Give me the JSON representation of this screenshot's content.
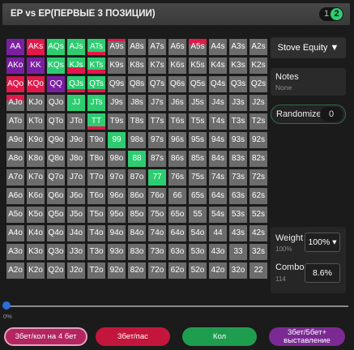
{
  "header": {
    "title": "EP vs EP(ПЕРВЫЕ 3 ПОЗИЦИИ)",
    "page_1": "1",
    "page_2": "2"
  },
  "colors": {
    "raise": "#e0194a",
    "call": "#2ecc71",
    "allin": "#7b1fa2",
    "fold": "#6c6c6c"
  },
  "grid": {
    "cells": [
      {
        "label": "AA",
        "fills": [
          {
            "color": "allin",
            "pct": 100
          }
        ]
      },
      {
        "label": "AKs",
        "fills": [
          {
            "color": "raise",
            "pct": 100
          }
        ]
      },
      {
        "label": "AQs",
        "fills": [
          {
            "color": "call",
            "pct": 100
          }
        ]
      },
      {
        "label": "AJs",
        "fills": [
          {
            "color": "call",
            "pct": 100
          }
        ]
      },
      {
        "label": "ATs",
        "fills": [
          {
            "color": "call",
            "pct": 80
          },
          {
            "color": "raise",
            "pct": 20
          }
        ]
      },
      {
        "label": "A9s",
        "fills": [
          {
            "color": "raise",
            "pct": 15
          }
        ]
      },
      {
        "label": "A8s",
        "fills": []
      },
      {
        "label": "A7s",
        "fills": []
      },
      {
        "label": "A6s",
        "fills": []
      },
      {
        "label": "A5s",
        "fills": [
          {
            "color": "raise",
            "pct": 35
          }
        ]
      },
      {
        "label": "A4s",
        "fills": []
      },
      {
        "label": "A3s",
        "fills": []
      },
      {
        "label": "A2s",
        "fills": []
      },
      {
        "label": "AKo",
        "fills": [
          {
            "color": "allin",
            "pct": 100
          }
        ]
      },
      {
        "label": "KK",
        "fills": [
          {
            "color": "allin",
            "pct": 100
          }
        ]
      },
      {
        "label": "KQs",
        "fills": [
          {
            "color": "call",
            "pct": 100
          }
        ]
      },
      {
        "label": "KJs",
        "fills": [
          {
            "color": "call",
            "pct": 60
          },
          {
            "color": "raise",
            "pct": 40
          }
        ]
      },
      {
        "label": "KTs",
        "fills": [
          {
            "color": "call",
            "pct": 75
          },
          {
            "color": "raise",
            "pct": 25
          }
        ]
      },
      {
        "label": "K9s",
        "fills": []
      },
      {
        "label": "K8s",
        "fills": []
      },
      {
        "label": "K7s",
        "fills": []
      },
      {
        "label": "K6s",
        "fills": []
      },
      {
        "label": "K5s",
        "fills": []
      },
      {
        "label": "K4s",
        "fills": []
      },
      {
        "label": "K3s",
        "fills": []
      },
      {
        "label": "K2s",
        "fills": []
      },
      {
        "label": "AQo",
        "fills": [
          {
            "color": "raise",
            "pct": 100
          }
        ]
      },
      {
        "label": "KQo",
        "fills": [
          {
            "color": "raise",
            "pct": 100
          }
        ]
      },
      {
        "label": "QQ",
        "fills": [
          {
            "color": "allin",
            "pct": 100
          }
        ]
      },
      {
        "label": "QJs",
        "fills": [
          {
            "color": "call",
            "pct": 80
          },
          {
            "color": "raise",
            "pct": 20
          }
        ]
      },
      {
        "label": "QTs",
        "fills": [
          {
            "color": "call",
            "pct": 80
          },
          {
            "color": "raise",
            "pct": 20
          }
        ]
      },
      {
        "label": "Q9s",
        "fills": []
      },
      {
        "label": "Q8s",
        "fills": []
      },
      {
        "label": "Q7s",
        "fills": []
      },
      {
        "label": "Q6s",
        "fills": []
      },
      {
        "label": "Q5s",
        "fills": []
      },
      {
        "label": "Q4s",
        "fills": []
      },
      {
        "label": "Q3s",
        "fills": []
      },
      {
        "label": "Q2s",
        "fills": []
      },
      {
        "label": "AJo",
        "fills": [
          {
            "color": "raise",
            "pct": 35
          }
        ]
      },
      {
        "label": "KJo",
        "fills": []
      },
      {
        "label": "QJo",
        "fills": []
      },
      {
        "label": "JJ",
        "fills": [
          {
            "color": "call",
            "pct": 100
          }
        ]
      },
      {
        "label": "JTs",
        "fills": [
          {
            "color": "call",
            "pct": 100
          }
        ]
      },
      {
        "label": "J9s",
        "fills": []
      },
      {
        "label": "J8s",
        "fills": []
      },
      {
        "label": "J7s",
        "fills": []
      },
      {
        "label": "J6s",
        "fills": []
      },
      {
        "label": "J5s",
        "fills": []
      },
      {
        "label": "J4s",
        "fills": []
      },
      {
        "label": "J3s",
        "fills": []
      },
      {
        "label": "J2s",
        "fills": []
      },
      {
        "label": "ATo",
        "fills": []
      },
      {
        "label": "KTo",
        "fills": []
      },
      {
        "label": "QTo",
        "fills": []
      },
      {
        "label": "JTo",
        "fills": []
      },
      {
        "label": "TT",
        "fills": [
          {
            "color": "call",
            "pct": 80
          },
          {
            "color": "raise",
            "pct": 20
          }
        ]
      },
      {
        "label": "T9s",
        "fills": []
      },
      {
        "label": "T8s",
        "fills": []
      },
      {
        "label": "T7s",
        "fills": []
      },
      {
        "label": "T6s",
        "fills": []
      },
      {
        "label": "T5s",
        "fills": []
      },
      {
        "label": "T4s",
        "fills": []
      },
      {
        "label": "T3s",
        "fills": []
      },
      {
        "label": "T2s",
        "fills": []
      },
      {
        "label": "A9o",
        "fills": []
      },
      {
        "label": "K9o",
        "fills": []
      },
      {
        "label": "Q9o",
        "fills": []
      },
      {
        "label": "J9o",
        "fills": []
      },
      {
        "label": "T9o",
        "fills": []
      },
      {
        "label": "99",
        "fills": [
          {
            "color": "call",
            "pct": 100
          }
        ]
      },
      {
        "label": "98s",
        "fills": []
      },
      {
        "label": "97s",
        "fills": []
      },
      {
        "label": "96s",
        "fills": []
      },
      {
        "label": "95s",
        "fills": []
      },
      {
        "label": "94s",
        "fills": []
      },
      {
        "label": "93s",
        "fills": []
      },
      {
        "label": "92s",
        "fills": []
      },
      {
        "label": "A8o",
        "fills": []
      },
      {
        "label": "K8o",
        "fills": []
      },
      {
        "label": "Q8o",
        "fills": []
      },
      {
        "label": "J8o",
        "fills": []
      },
      {
        "label": "T8o",
        "fills": []
      },
      {
        "label": "98o",
        "fills": []
      },
      {
        "label": "88",
        "fills": [
          {
            "color": "call",
            "pct": 100
          }
        ]
      },
      {
        "label": "87s",
        "fills": []
      },
      {
        "label": "86s",
        "fills": []
      },
      {
        "label": "85s",
        "fills": []
      },
      {
        "label": "84s",
        "fills": []
      },
      {
        "label": "83s",
        "fills": []
      },
      {
        "label": "82s",
        "fills": []
      },
      {
        "label": "A7o",
        "fills": []
      },
      {
        "label": "K7o",
        "fills": []
      },
      {
        "label": "Q7o",
        "fills": []
      },
      {
        "label": "J7o",
        "fills": []
      },
      {
        "label": "T7o",
        "fills": []
      },
      {
        "label": "97o",
        "fills": []
      },
      {
        "label": "87o",
        "fills": []
      },
      {
        "label": "77",
        "fills": [
          {
            "color": "call",
            "pct": 100
          }
        ]
      },
      {
        "label": "76s",
        "fills": []
      },
      {
        "label": "75s",
        "fills": []
      },
      {
        "label": "74s",
        "fills": []
      },
      {
        "label": "73s",
        "fills": []
      },
      {
        "label": "72s",
        "fills": []
      },
      {
        "label": "A6o",
        "fills": []
      },
      {
        "label": "K6o",
        "fills": []
      },
      {
        "label": "Q6o",
        "fills": []
      },
      {
        "label": "J6o",
        "fills": []
      },
      {
        "label": "T6o",
        "fills": []
      },
      {
        "label": "96o",
        "fills": []
      },
      {
        "label": "86o",
        "fills": []
      },
      {
        "label": "76o",
        "fills": []
      },
      {
        "label": "66",
        "fills": []
      },
      {
        "label": "65s",
        "fills": []
      },
      {
        "label": "64s",
        "fills": []
      },
      {
        "label": "63s",
        "fills": []
      },
      {
        "label": "62s",
        "fills": []
      },
      {
        "label": "A5o",
        "fills": []
      },
      {
        "label": "K5o",
        "fills": []
      },
      {
        "label": "Q5o",
        "fills": []
      },
      {
        "label": "J5o",
        "fills": []
      },
      {
        "label": "T5o",
        "fills": []
      },
      {
        "label": "95o",
        "fills": []
      },
      {
        "label": "85o",
        "fills": []
      },
      {
        "label": "75o",
        "fills": []
      },
      {
        "label": "65o",
        "fills": []
      },
      {
        "label": "55",
        "fills": []
      },
      {
        "label": "54s",
        "fills": []
      },
      {
        "label": "53s",
        "fills": []
      },
      {
        "label": "52s",
        "fills": []
      },
      {
        "label": "A4o",
        "fills": []
      },
      {
        "label": "K4o",
        "fills": []
      },
      {
        "label": "Q4o",
        "fills": []
      },
      {
        "label": "J4o",
        "fills": []
      },
      {
        "label": "T4o",
        "fills": []
      },
      {
        "label": "94o",
        "fills": []
      },
      {
        "label": "84o",
        "fills": []
      },
      {
        "label": "74o",
        "fills": []
      },
      {
        "label": "64o",
        "fills": []
      },
      {
        "label": "54o",
        "fills": []
      },
      {
        "label": "44",
        "fills": []
      },
      {
        "label": "43s",
        "fills": []
      },
      {
        "label": "42s",
        "fills": []
      },
      {
        "label": "A3o",
        "fills": []
      },
      {
        "label": "K3o",
        "fills": []
      },
      {
        "label": "Q3o",
        "fills": []
      },
      {
        "label": "J3o",
        "fills": []
      },
      {
        "label": "T3o",
        "fills": []
      },
      {
        "label": "93o",
        "fills": []
      },
      {
        "label": "83o",
        "fills": []
      },
      {
        "label": "73o",
        "fills": []
      },
      {
        "label": "63o",
        "fills": []
      },
      {
        "label": "53o",
        "fills": []
      },
      {
        "label": "43o",
        "fills": []
      },
      {
        "label": "33",
        "fills": []
      },
      {
        "label": "32s",
        "fills": []
      },
      {
        "label": "A2o",
        "fills": []
      },
      {
        "label": "K2o",
        "fills": []
      },
      {
        "label": "Q2o",
        "fills": []
      },
      {
        "label": "J2o",
        "fills": []
      },
      {
        "label": "T2o",
        "fills": []
      },
      {
        "label": "92o",
        "fills": []
      },
      {
        "label": "82o",
        "fills": []
      },
      {
        "label": "72o",
        "fills": []
      },
      {
        "label": "62o",
        "fills": []
      },
      {
        "label": "52o",
        "fills": []
      },
      {
        "label": "42o",
        "fills": []
      },
      {
        "label": "32o",
        "fills": []
      },
      {
        "label": "22",
        "fills": []
      }
    ]
  },
  "side": {
    "stove_label": "Stove Equity ▼",
    "notes_title": "Notes",
    "notes_value": "None",
    "randomizer_label": "Randomizer",
    "randomizer_value": "0",
    "weight_label": "Weight",
    "weight_sub": "100%",
    "weight_value": "100% ▾",
    "combos_label": "Combos",
    "combos_sub": "114",
    "combos_value": "8.6%"
  },
  "slider": {
    "value_label": "0%",
    "value": 0
  },
  "actions": {
    "b1": "3бет/кол на 4 бет",
    "b2": "3бет/пас",
    "b3": "Кол",
    "b4": "3бет/5бет+ выставление"
  }
}
